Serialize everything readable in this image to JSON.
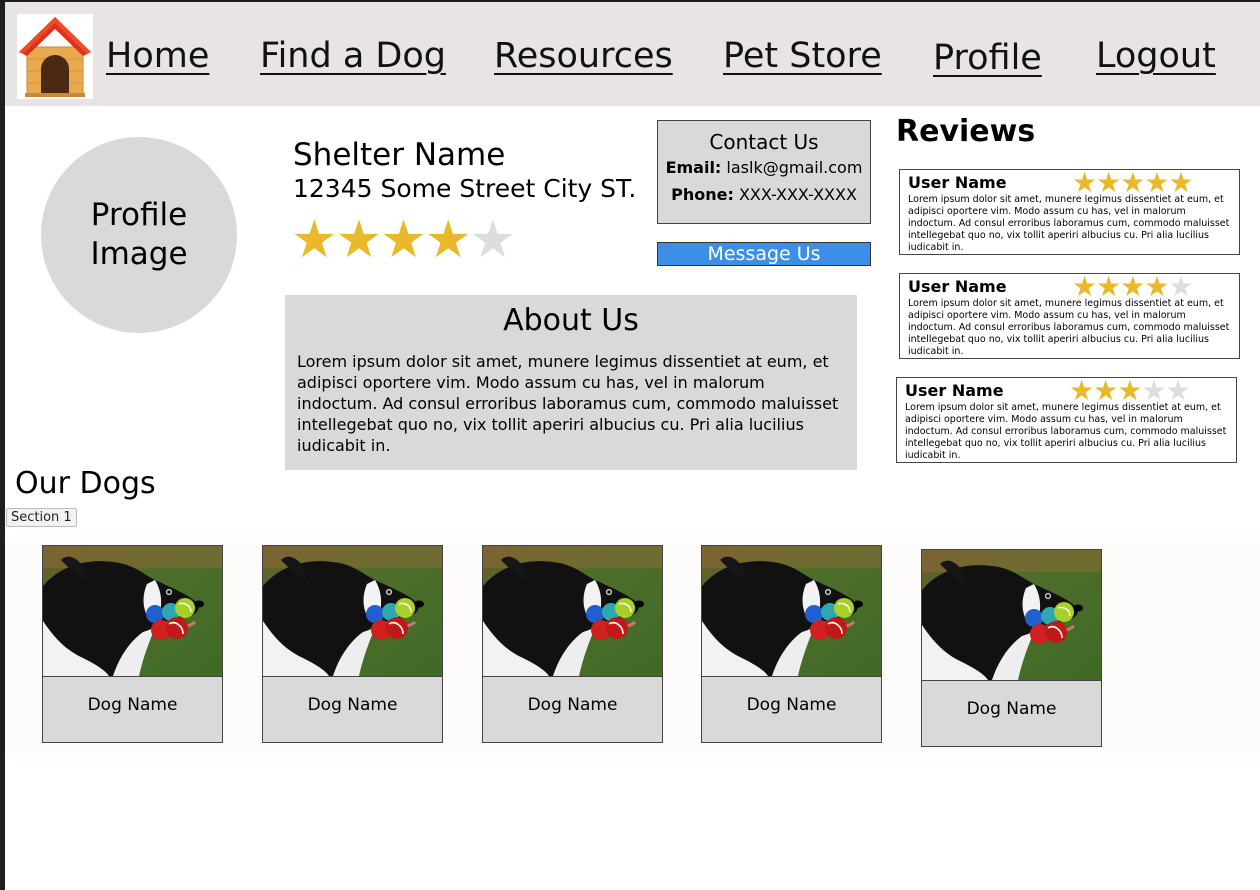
{
  "nav": {
    "links": [
      "Home",
      "Find a Dog",
      "Resources",
      "Pet Store",
      "Profile",
      "Logout"
    ]
  },
  "profile": {
    "image_label": "Profile\nImage"
  },
  "shelter": {
    "name": "Shelter Name",
    "address": "12345 Some Street City ST.",
    "rating": 4,
    "max_rating": 5
  },
  "contact": {
    "title": "Contact Us",
    "email_label": "Email:",
    "email": "laslk@gmail.com",
    "phone_label": "Phone:",
    "phone": "XXX-XXX-XXXX",
    "message_button": "Message Us"
  },
  "about": {
    "title": "About Us",
    "text": "Lorem ipsum dolor sit amet, munere legimus dissentiet at eum, et adipisci oportere vim. Modo assum cu has, vel in malorum indoctum. Ad consul erroribus laboramus cum, commodo maluisset intellegebat quo no, vix tollit aperiri albucius cu. Pri alia lucilius iudicabit in."
  },
  "reviews": {
    "title": "Reviews",
    "items": [
      {
        "user": "User Name",
        "rating": 5,
        "text": "Lorem ipsum dolor sit amet, munere legimus dissentiet at eum, et adipisci oportere vim. Modo assum cu has, vel in malorum indoctum. Ad consul erroribus laboramus cum, commodo maluisset intellegebat quo no, vix tollit aperiri albucius cu. Pri alia lucilius iudicabit in."
      },
      {
        "user": "User Name",
        "rating": 4,
        "text": "Lorem ipsum dolor sit amet, munere legimus dissentiet at eum, et adipisci oportere vim. Modo assum cu has, vel in malorum indoctum. Ad consul erroribus laboramus cum, commodo maluisset intellegebat quo no, vix tollit aperiri albucius cu. Pri alia lucilius iudicabit in."
      },
      {
        "user": "User Name",
        "rating": 3,
        "text": "Lorem ipsum dolor sit amet, munere legimus dissentiet at eum, et adipisci oportere vim. Modo assum cu has, vel in malorum indoctum. Ad consul erroribus laboramus cum, commodo maluisset intellegebat quo no, vix tollit aperiri albucius cu. Pri alia lucilius iudicabit in."
      }
    ]
  },
  "dogs": {
    "title": "Our Dogs",
    "section_label": "Section 1",
    "items": [
      {
        "name": "Dog Name"
      },
      {
        "name": "Dog Name"
      },
      {
        "name": "Dog Name"
      },
      {
        "name": "Dog Name"
      },
      {
        "name": "Dog Name"
      }
    ]
  },
  "colors": {
    "nav_bg": "#e9e4e4",
    "star": "#e9b92a",
    "star_off": "#dddddd",
    "message_button": "#3b8fe6",
    "panel_gray": "#d9d9d9"
  },
  "icons": {
    "logo": "dog-house-icon",
    "star": "star-icon"
  }
}
